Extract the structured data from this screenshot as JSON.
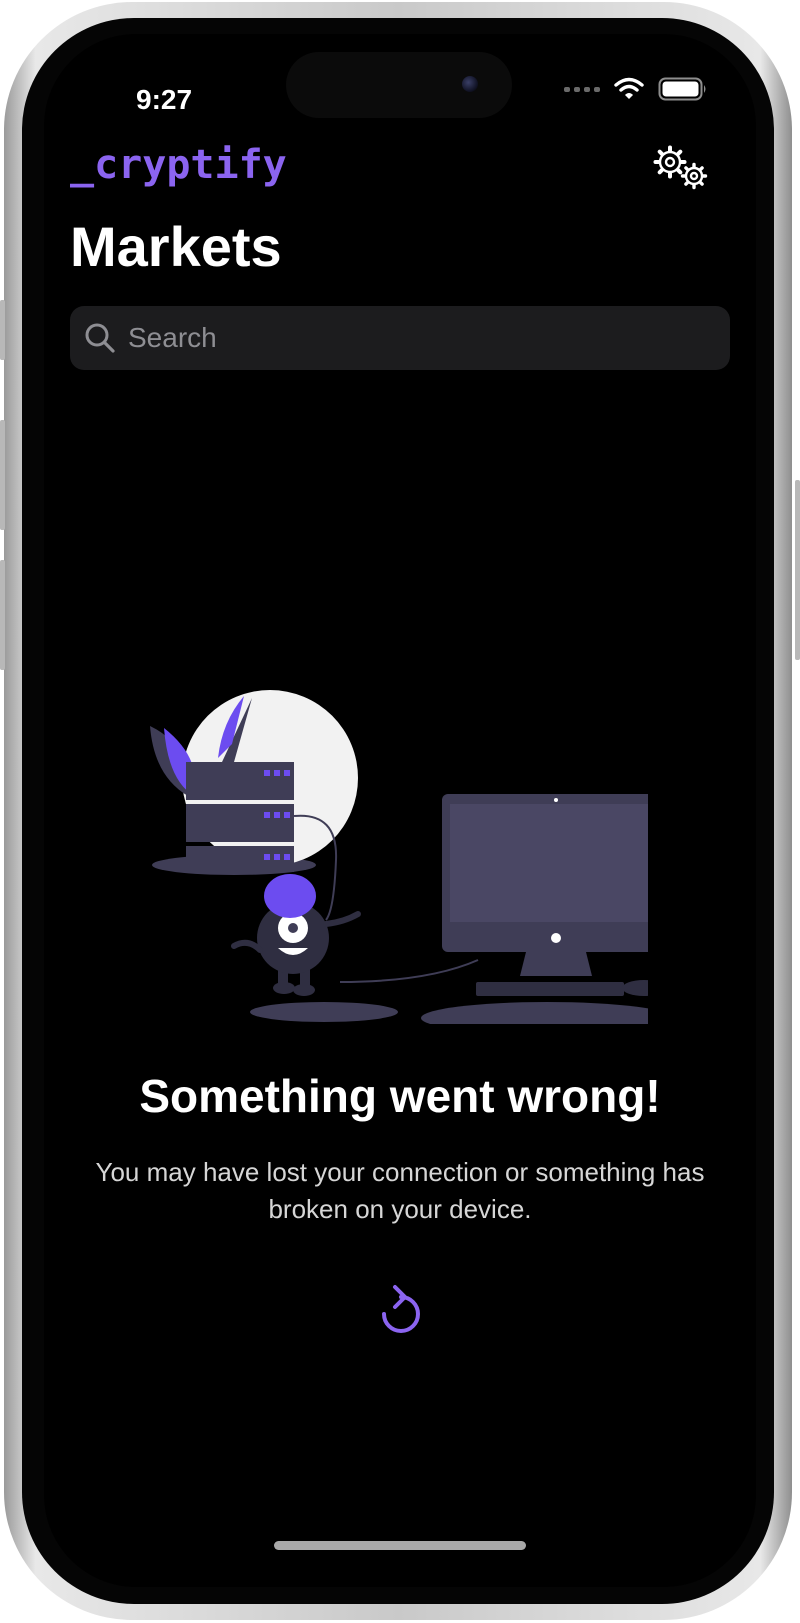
{
  "status_bar": {
    "time": "9:27"
  },
  "app": {
    "logo": "_cryptify",
    "title": "Markets"
  },
  "search": {
    "placeholder": "Search"
  },
  "error": {
    "title": "Something went wrong!",
    "message": "You may have lost your connection or something has broken on your device."
  },
  "icons": [
    "wifi-icon",
    "battery-icon",
    "settings-gears-icon",
    "search-icon",
    "retry-icon"
  ],
  "colors": {
    "accent": "#8b64f0",
    "background": "#000000",
    "search_field": "#1c1c1e",
    "illustration": "#3f3d56"
  }
}
